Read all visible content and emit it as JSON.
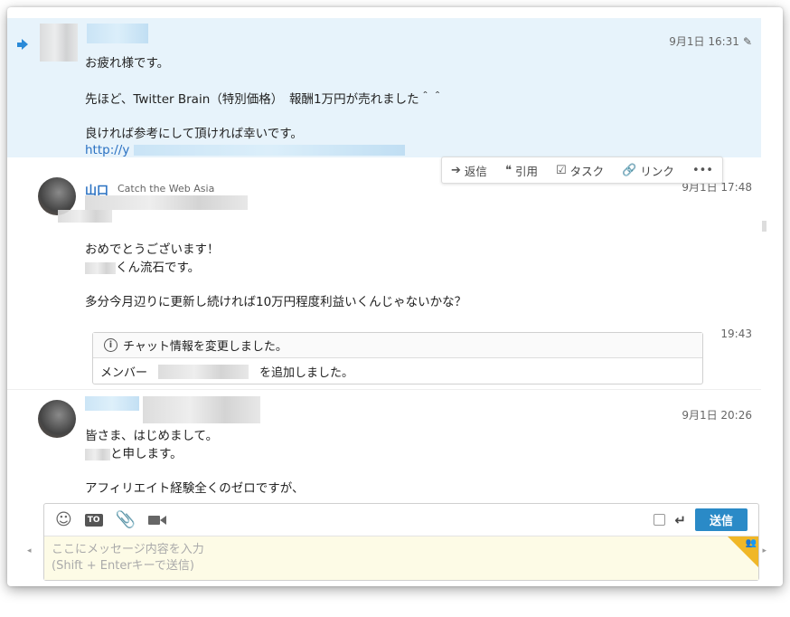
{
  "colors": {
    "accent": "#2a8ac7",
    "link": "#2a71c2",
    "highlight_bg": "#e7f3fb",
    "composer_bg": "#fdfbe6"
  },
  "messages": [
    {
      "timestamp": "9月1日 16:31",
      "lines": [
        "お疲れ様です。",
        "先ほど、Twitter Brain（特別価格）　報酬1万円が売れました＾＾",
        "良ければ参考にして頂ければ幸いです。"
      ],
      "link_text": "http://y"
    },
    {
      "sender_name": "山口",
      "sender_org": "Catch the Web Asia",
      "timestamp": "9月1日 17:48",
      "lines": [
        "おめでとうございます！",
        "くん流石です。",
        "多分今月辺りに更新し続ければ10万円程度利益いくんじゃないかな？"
      ]
    },
    {
      "timestamp": "9月1日 20:26",
      "lines": [
        "皆さま、はじめまして。",
        "と申します。",
        "アフィリエイト経験全くのゼロですが、"
      ]
    }
  ],
  "system_notice": {
    "timestamp": "19:43",
    "title": "チャット情報を変更しました。",
    "member_label": "メンバー",
    "added_text": "を追加しました。"
  },
  "actions": [
    {
      "icon": "reply-icon",
      "glyph": "➔",
      "label": "返信"
    },
    {
      "icon": "quote-icon",
      "glyph": "❝",
      "label": "引用"
    },
    {
      "icon": "task-icon",
      "glyph": "☑",
      "label": "タスク"
    },
    {
      "icon": "link-icon",
      "glyph": "🔗",
      "label": "リンク"
    },
    {
      "icon": "more-icon",
      "glyph": "•••",
      "label": ""
    }
  ],
  "composer": {
    "to_label": "TO",
    "send_label": "送信",
    "placeholder": "ここにメッセージ内容を入力\n(Shift + Enterキーで送信)"
  }
}
